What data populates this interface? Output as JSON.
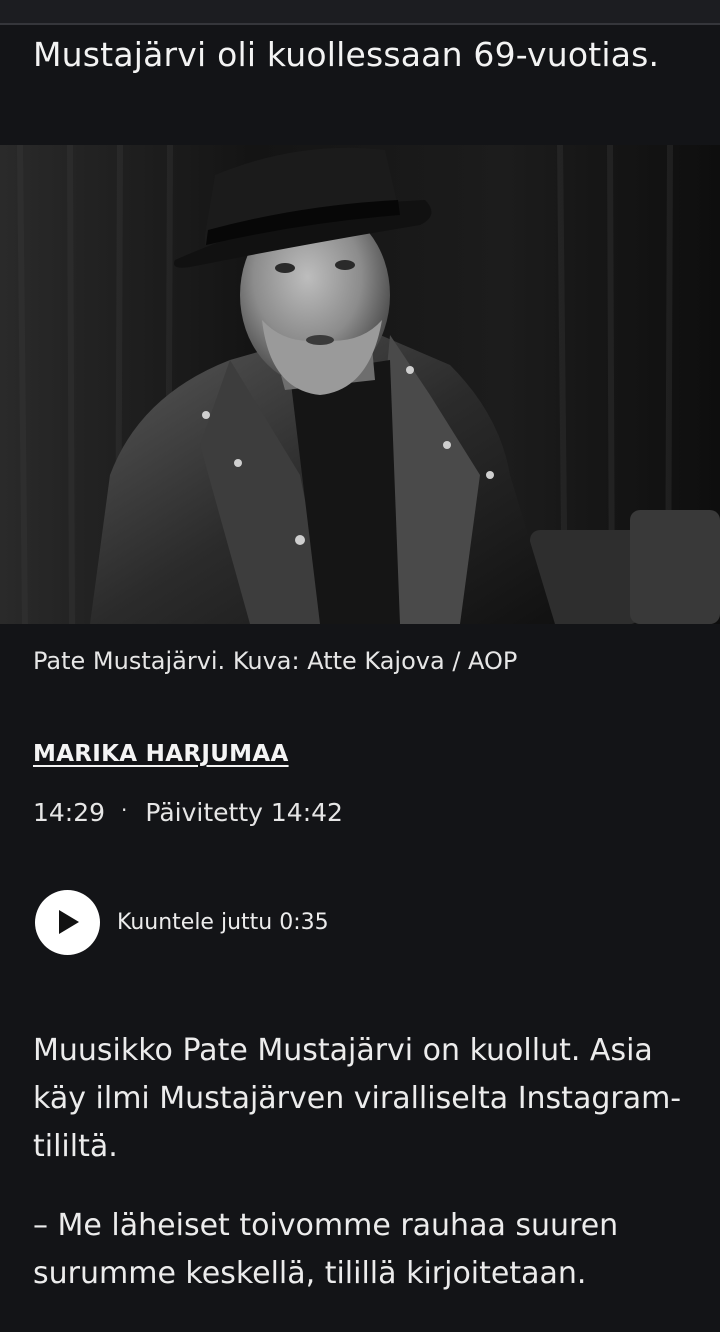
{
  "article": {
    "lead": "Mustajärvi oli kuollessaan 69-vuotias.",
    "image_caption": "Pate Mustajärvi. Kuva: Atte Kajova / AOP",
    "author": "MARIKA HARJUMAA",
    "published": "14:29",
    "separator": "·",
    "updated": "Päivitetty 14:42",
    "listen": {
      "label": "Kuuntele juttu 0:35",
      "icon": "play-icon"
    },
    "paragraphs": [
      "Muusikko Pate Mustajärvi on kuollut. Asia käy ilmi Mustajärven viralliselta Instagram-tililtä.",
      "– Me läheiset toivomme rauhaa suuren surumme keskellä, tilillä kirjoitetaan."
    ]
  },
  "colors": {
    "background": "#131417",
    "text": "#f2f2f2",
    "play_button": "#ffffff"
  }
}
